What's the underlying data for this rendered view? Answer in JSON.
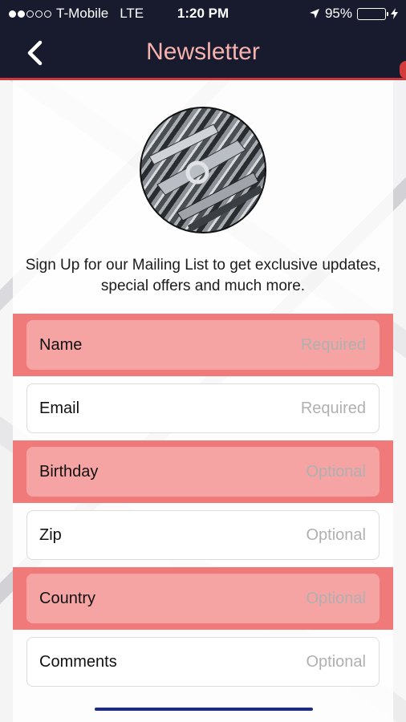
{
  "status_bar": {
    "carrier": "T-Mobile",
    "network": "LTE",
    "time": "1:20 PM",
    "battery": "95%",
    "signal_bars_filled": 2,
    "signal_bars_total": 5
  },
  "nav": {
    "title": "Newsletter",
    "back_icon": "chevron-left-icon"
  },
  "intro_text": "Sign Up for our Mailing List to get exclusive updates, special offers and much more.",
  "fields": [
    {
      "label": "Name",
      "placeholder": "Required"
    },
    {
      "label": "Email",
      "placeholder": "Required"
    },
    {
      "label": "Birthday",
      "placeholder": "Optional"
    },
    {
      "label": "Zip",
      "placeholder": "Optional"
    },
    {
      "label": "Country",
      "placeholder": "Optional"
    },
    {
      "label": "Comments",
      "placeholder": "Optional"
    }
  ],
  "colors": {
    "nav_bg": "#181a2e",
    "nav_title": "#f6b3ae",
    "highlight_row": "#f07a7a",
    "battery": "#4cd964"
  }
}
